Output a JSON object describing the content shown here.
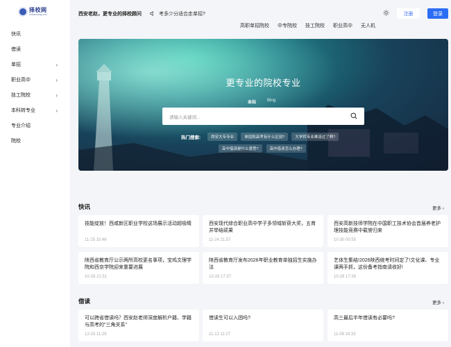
{
  "logo": {
    "main": "择校网",
    "sub": "zexiaowang.com"
  },
  "sidebar": {
    "items": [
      {
        "label": "快讯",
        "chevron": false
      },
      {
        "label": "借读",
        "chevron": false
      },
      {
        "label": "单招",
        "chevron": true
      },
      {
        "label": "职业高中",
        "chevron": true
      },
      {
        "label": "技工院校",
        "chevron": true
      },
      {
        "label": "本科转专业",
        "chevron": true
      },
      {
        "label": "专业介绍",
        "chevron": false
      },
      {
        "label": "院校",
        "chevron": false
      }
    ]
  },
  "header": {
    "slogan": "西安老赵，更专业的择校顾问",
    "notice": "考多少分适合走单招?",
    "register": "注册",
    "login": "登录",
    "links": [
      "高职单招院校",
      "中专院校",
      "技工院校",
      "职业高中",
      "无人机"
    ]
  },
  "hero": {
    "title": "更专业的院校专业",
    "tabs": [
      "本站",
      "Bing"
    ],
    "search_placeholder": "请输入关键词...",
    "hot_label": "热门搜索:",
    "hot_tags": [
      "西安大专专业",
      "单招和高考有什么区别?",
      "大学转专业难设过了啊?",
      "高中借读是什么意思?",
      "高中借读怎么办理?"
    ]
  },
  "news": {
    "title": "快讯",
    "more": "更多",
    "cards": [
      {
        "title": "技能绽放！西咸新区职业学校这场展示活动超吸睛",
        "date": "11-25 10:46"
      },
      {
        "title": "西安现代综合职业高中学子多领域斩获大奖，五育并举结硕果",
        "date": "11-24 21:57"
      },
      {
        "title": "西安高新技师学院在中国职工技术协会首届养老护理技能竞赛中载誉归来",
        "date": "10-30 00:55"
      },
      {
        "title": "陕西省教育厅公示两所高校更名事项，宝鸡文理学院和西京学院迎来重要进展",
        "date": "10-28 21:51"
      },
      {
        "title": "陕西省教育厅发布2026年职业教育单独招生实施办法",
        "date": "10-28 17:37"
      },
      {
        "title": "艺体生集结!2026陕西统考时间定了!文化课、专业课两手抓，这份备考指南请收好!",
        "date": "10-28 17:26"
      }
    ]
  },
  "jiedu": {
    "title": "借读",
    "more": "更多",
    "cards": [
      {
        "title": "可以跨省借读吗？西安赵老师深度解析户籍、学籍与高考的\"三角关系\"",
        "date": "12-03 11:29"
      },
      {
        "title": "借读生可以入团吗?",
        "date": "11-12 11:27"
      },
      {
        "title": "高三最后半年借读有必要吗?",
        "date": "11-08 19:33"
      }
    ]
  }
}
